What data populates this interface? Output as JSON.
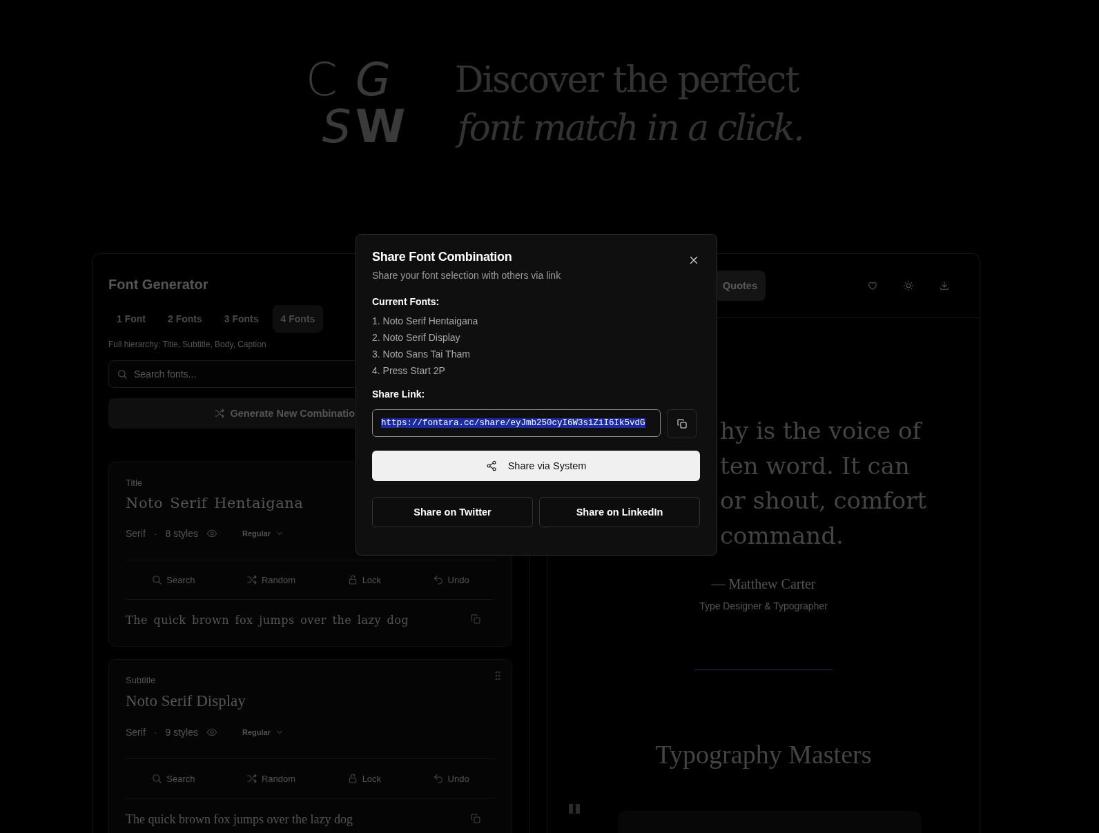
{
  "hero": {
    "logo_letters": [
      {
        "text": "C",
        "kind": "plain"
      },
      {
        "text": "G",
        "kind": "italic"
      },
      {
        "text": "S",
        "kind": "italic"
      },
      {
        "text": "W",
        "kind": "bold"
      }
    ],
    "headline": "Discover the perfect",
    "headline_italic": "font match in a click."
  },
  "generator": {
    "title": "Font Generator",
    "tabs": [
      {
        "label": "1 Font",
        "selected": false
      },
      {
        "label": "2 Fonts",
        "selected": false
      },
      {
        "label": "3 Fonts",
        "selected": false
      },
      {
        "label": "4 Fonts",
        "selected": true
      }
    ],
    "hint": "Full hierarchy: Title, Subtitle, Body, Caption",
    "search": {
      "placeholder": "Search fonts..."
    },
    "generate_button": "Generate New Combinatio",
    "cards": [
      {
        "role": "Title",
        "font": "Noto Serif Hentaigana",
        "kind": "spaced",
        "category": "Serif",
        "separator": "·",
        "styles": "8 styles",
        "weight": "Regular",
        "actions": [
          "Search",
          "Random",
          "Lock",
          "Undo"
        ],
        "sample": "The quick brown fox jumps over the lazy dog"
      },
      {
        "role": "Subtitle",
        "font": "Noto Serif Display",
        "kind": "display",
        "category": "Serif",
        "separator": "·",
        "styles": "9 styles",
        "weight": "Regular",
        "actions": [
          "Search",
          "Random",
          "Lock",
          "Undo"
        ],
        "sample": "The quick brown fox jumps over the lazy dog",
        "draggable": true
      }
    ]
  },
  "preview": {
    "tabs": [
      {
        "label": "Quotes",
        "selected": true
      }
    ],
    "quote_lines": [
      "hy is the voice of",
      "ten word. It can",
      "or shout, comfort",
      "command."
    ],
    "author": "— Matthew Carter",
    "author_role": "Type Designer & Typographer",
    "section_title": "Typography Masters"
  },
  "modal": {
    "title": "Share Font Combination",
    "subtitle": "Share your font selection with others via link",
    "fonts_heading": "Current Fonts:",
    "fonts": [
      "1. Noto Serif Hentaigana",
      "2. Noto Serif Display",
      "3. Noto Sans Tai Tham",
      "4. Press Start 2P"
    ],
    "link_heading": "Share Link:",
    "link": "https://fontara.cc/share/eyJmb250cyI6W3siZiI6Ik5vdG",
    "link_selected": true,
    "system_button": "Share via System",
    "social_buttons": [
      "Share on Twitter",
      "Share on LinkedIn"
    ]
  }
}
